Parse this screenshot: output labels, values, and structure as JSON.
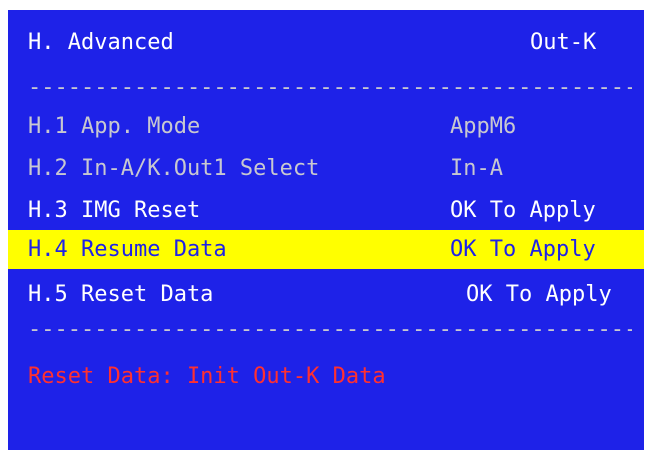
{
  "header": {
    "title": "H. Advanced",
    "right": "Out-K"
  },
  "divider": "------------------------------------------------------------",
  "menu": {
    "items": [
      {
        "label": "H.1 App. Mode",
        "value": "AppM6",
        "highlighted": false,
        "dim": true
      },
      {
        "label": "H.2 In-A/K.Out1 Select",
        "value": "In-A",
        "highlighted": false,
        "dim": true
      },
      {
        "label": "H.3 IMG Reset",
        "value": "OK To Apply",
        "highlighted": false,
        "dim": false
      },
      {
        "label": "H.4 Resume Data",
        "value": "OK To Apply",
        "highlighted": true,
        "dim": false
      },
      {
        "label": "H.5 Reset Data",
        "value": "OK To Apply",
        "highlighted": false,
        "dim": false
      }
    ]
  },
  "status": {
    "text": "Reset Data: Init Out-K Data"
  },
  "colors": {
    "background": "#1e22e8",
    "text": "#ffffff",
    "highlight": "#ffff00",
    "status": "#ff3030"
  }
}
